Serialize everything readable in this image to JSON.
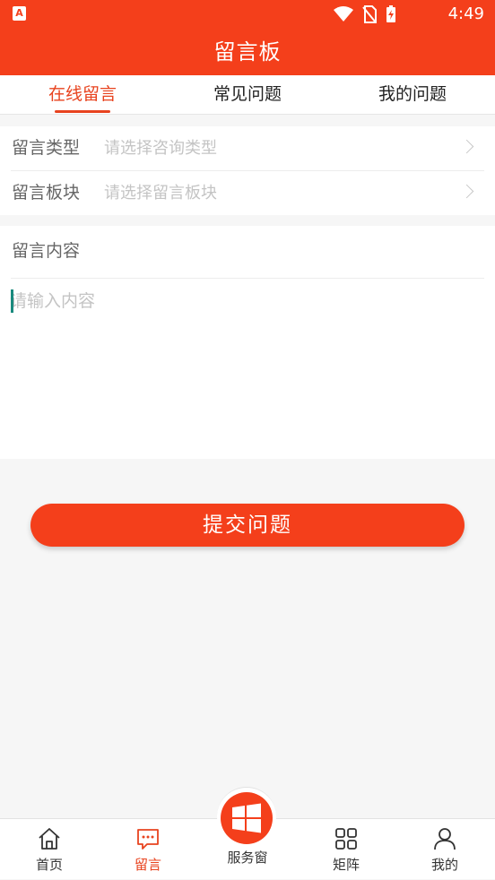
{
  "status_bar": {
    "app_badge": "A",
    "time": "4:49",
    "icons": [
      "wifi-icon",
      "no-sim-icon",
      "battery-charging-icon"
    ]
  },
  "header": {
    "title": "留言板"
  },
  "tabs": [
    {
      "label": "在线留言",
      "active": true
    },
    {
      "label": "常见问题",
      "active": false
    },
    {
      "label": "我的问题",
      "active": false
    }
  ],
  "form": {
    "type_row": {
      "label": "留言类型",
      "placeholder": "请选择咨询类型"
    },
    "board_row": {
      "label": "留言板块",
      "placeholder": "请选择留言板块"
    }
  },
  "content": {
    "label": "留言内容",
    "placeholder": "请输入内容",
    "value": ""
  },
  "submit": {
    "label": "提交问题"
  },
  "bottom_nav": {
    "items": [
      {
        "label": "首页",
        "icon": "home-icon",
        "active": false
      },
      {
        "label": "留言",
        "icon": "message-icon",
        "active": true
      },
      {
        "label": "服务窗",
        "icon": "windows-icon",
        "active": false
      },
      {
        "label": "矩阵",
        "icon": "grid-icon",
        "active": false
      },
      {
        "label": "我的",
        "icon": "user-icon",
        "active": false
      }
    ]
  },
  "colors": {
    "brand": "#f43f1b",
    "active": "#e8431f",
    "placeholder": "#c4c4c4"
  }
}
